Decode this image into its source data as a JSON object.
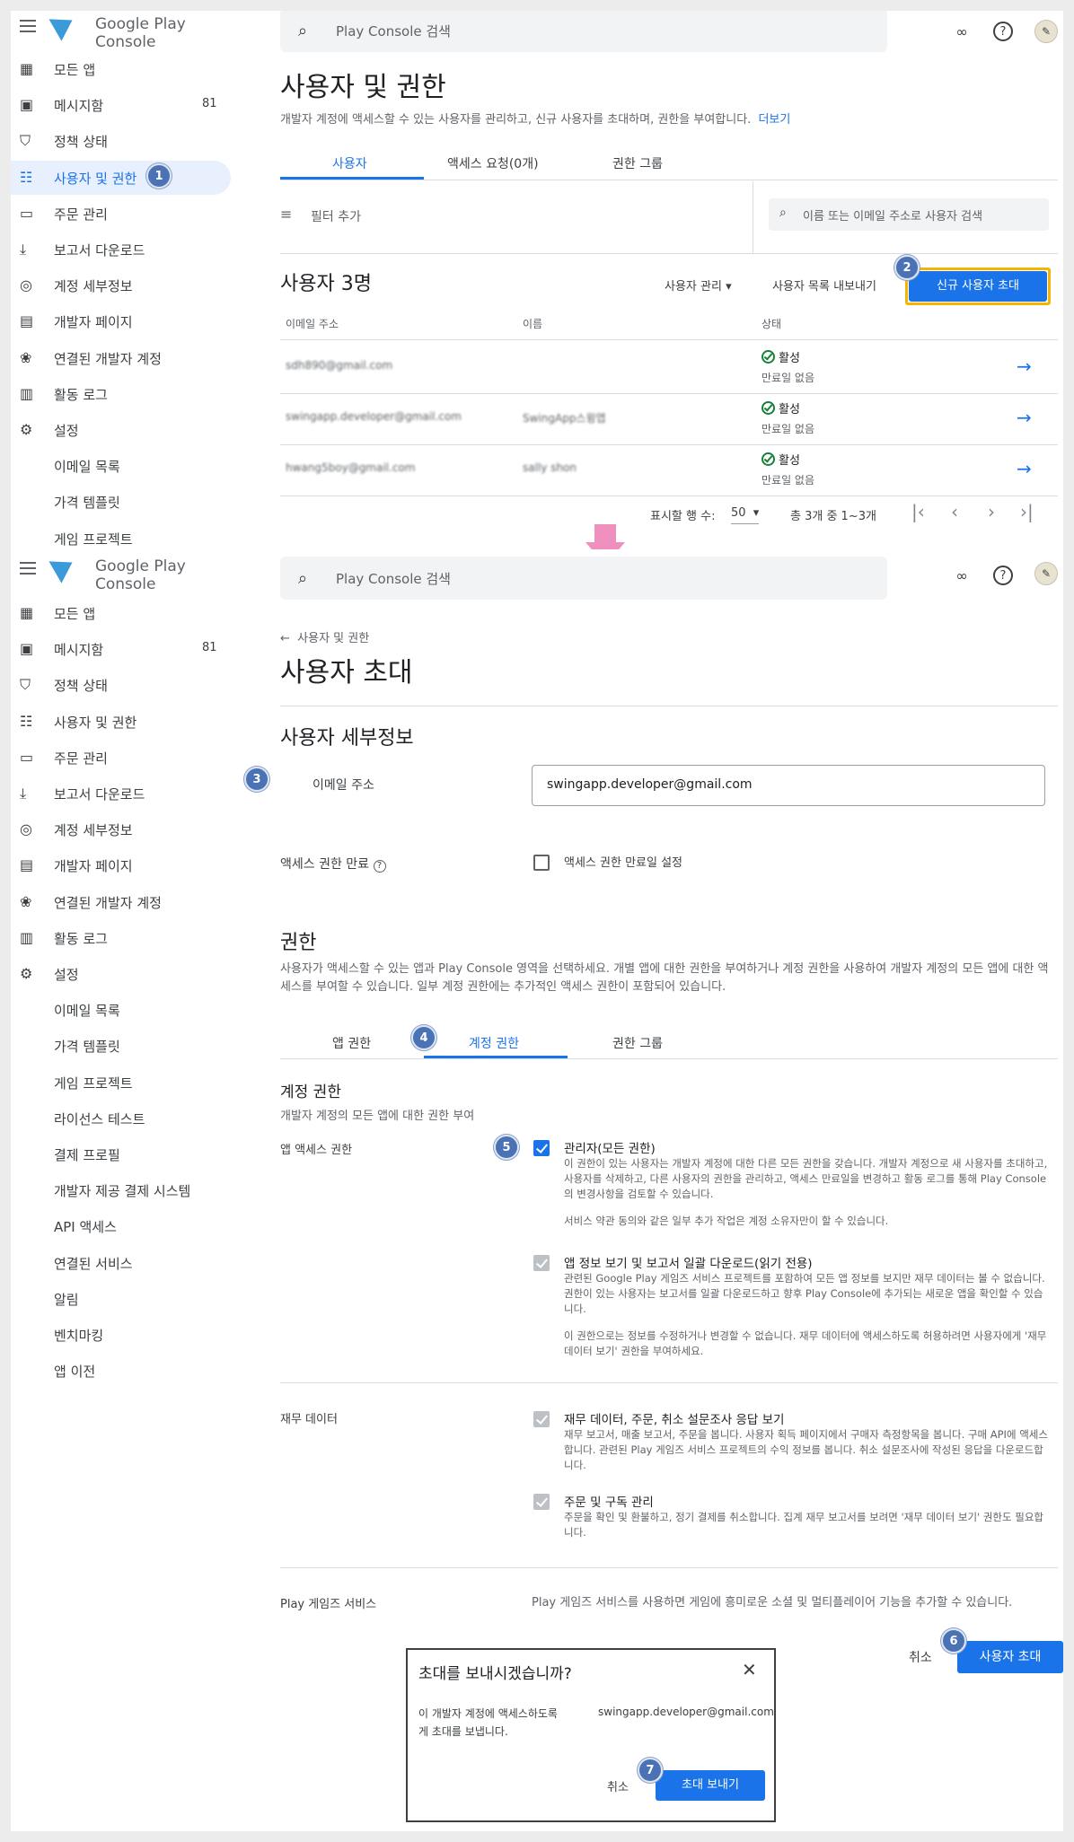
{
  "app": {
    "brand": "Google Play Console",
    "search_placeholder": "Play Console 검색"
  },
  "nav1": [
    {
      "label": "모든 앱",
      "icon": "grid-icon"
    },
    {
      "label": "메시지함",
      "count": "81",
      "icon": "inbox-icon"
    },
    {
      "label": "정책 상태",
      "icon": "shield-icon"
    },
    {
      "label": "사용자 및 권한",
      "icon": "users-icon",
      "selected": true
    },
    {
      "label": "주문 관리",
      "icon": "card-icon"
    },
    {
      "label": "보고서 다운로드",
      "icon": "download-icon"
    },
    {
      "label": "계정 세부정보",
      "icon": "account-icon"
    },
    {
      "label": "개발자 페이지",
      "icon": "page-icon"
    },
    {
      "label": "연결된 개발자 계정",
      "icon": "palette-icon"
    },
    {
      "label": "활동 로그",
      "icon": "doc-icon"
    },
    {
      "label": "설정",
      "icon": "gear-icon"
    },
    {
      "label": "이메일 목록"
    },
    {
      "label": "가격 템플릿"
    },
    {
      "label": "게임 프로젝트"
    }
  ],
  "nav2": [
    {
      "label": "모든 앱"
    },
    {
      "label": "메시지함",
      "count": "81"
    },
    {
      "label": "정책 상태"
    },
    {
      "label": "사용자 및 권한"
    },
    {
      "label": "주문 관리"
    },
    {
      "label": "보고서 다운로드"
    },
    {
      "label": "계정 세부정보"
    },
    {
      "label": "개발자 페이지"
    },
    {
      "label": "연결된 개발자 계정"
    },
    {
      "label": "활동 로그"
    },
    {
      "label": "설정"
    },
    {
      "label": "이메일 목록"
    },
    {
      "label": "가격 템플릿"
    },
    {
      "label": "게임 프로젝트"
    },
    {
      "label": "라이선스 테스트"
    },
    {
      "label": "결제 프로필"
    },
    {
      "label": "개발자 제공 결제 시스템"
    },
    {
      "label": "API 액세스"
    },
    {
      "label": "연결된 서비스"
    },
    {
      "label": "알림"
    },
    {
      "label": "벤치마킹"
    },
    {
      "label": "앱 이전"
    }
  ],
  "users_page": {
    "title": "사용자 및 권한",
    "subtitle": "개발자 계정에 액세스할 수 있는 사용자를 관리하고, 신규 사용자를 초대하며, 권한을 부여합니다.",
    "more_link": "더보기",
    "tabs": [
      "사용자",
      "액세스 요청(0개)",
      "권한 그룹"
    ],
    "filter": "필터 추가",
    "user_search": "이름 또는 이메일 주소로 사용자 검색",
    "count_title": "사용자 3명",
    "manage": "사용자 관리",
    "export": "사용자 목록 내보내기",
    "invite": "신규 사용자 초대",
    "columns": [
      "이메일 주소",
      "이름",
      "상태"
    ],
    "rows": [
      {
        "email": "sdh890@gmail.com",
        "name": "",
        "status": "활성",
        "expiry": "만료일 없음"
      },
      {
        "email": "swingapp.developer@gmail.com",
        "name": "SwingApp스윙앱",
        "status": "활성",
        "expiry": "만료일 없음"
      },
      {
        "email": "hwang5boy@gmail.com",
        "name": "sally shon",
        "status": "활성",
        "expiry": "만료일 없음"
      }
    ],
    "rows_label": "표시할 행 수:",
    "rows_value": "50",
    "range": "총 3개 중 1~3개"
  },
  "invite_page": {
    "back": "사용자 및 권한",
    "title": "사용자 초대",
    "details_title": "사용자 세부정보",
    "email_label": "이메일 주소",
    "email_value": "swingapp.developer@gmail.com",
    "expiry_label": "액세스 권한 만료",
    "expiry_checkbox": "액세스 권한 만료일 설정",
    "perm_title": "권한",
    "perm_desc": "사용자가 액세스할 수 있는 앱과 Play Console 영역을 선택하세요. 개별 앱에 대한 권한을 부여하거나 계정 권한을 사용하여 개발자 계정의 모든 앱에 대한 액세스를 부여할 수 있습니다. 일부 계정 권한에는 추가적인 액세스 권한이 포함되어 있습니다.",
    "tabs": [
      "앱 권한",
      "계정 권한",
      "권한 그룹"
    ],
    "acct_title": "계정 권한",
    "acct_sub": "개발자 계정의 모든 앱에 대한 권한 부여",
    "app_access": "앱 액세스 권한",
    "admin_label": "관리자(모든 권한)",
    "admin_desc": "이 권한이 있는 사용자는 개발자 계정에 대한 다른 모든 권한을 갖습니다. 개발자 계정으로 새 사용자를 초대하고, 사용자를 삭제하고, 다른 사용자의 권한을 관리하고, 액세스 만료일을 변경하고 활동 로그를 통해 Play Console의 변경사항을 검토할 수 있습니다.",
    "admin_desc2": "서비스 약관 동의와 같은 일부 추가 작업은 계정 소유자만이 할 수 있습니다.",
    "view_label": "앱 정보 보기 및 보고서 일괄 다운로드(읽기 전용)",
    "view_desc": "관련된 Google Play 게임즈 서비스 프로젝트를 포함하여 모든 앱 정보를 보지만 재무 데이터는 볼 수 없습니다. 권한이 있는 사용자는 보고서를 일괄 다운로드하고 향후 Play Console에 추가되는 새로운 앱을 확인할 수 있습니다.",
    "view_desc2": "이 권한으로는 정보를 수정하거나 변경할 수 없습니다. 재무 데이터에 액세스하도록 허용하려면 사용자에게 '재무 데이터 보기' 권한을 부여하세요.",
    "finance": "재무 데이터",
    "fin1_label": "재무 데이터, 주문, 취소 설문조사 응답 보기",
    "fin1_desc": "재무 보고서, 매출 보고서, 주문을 봅니다. 사용자 획득 페이지에서 구매자 측정항목을 봅니다. 구매 API에 액세스합니다. 관련된 Play 게임즈 서비스 프로젝트의 수익 정보를 봅니다. 취소 설문조사에 작성된 응답을 다운로드합니다.",
    "fin2_label": "주문 및 구독 관리",
    "fin2_desc": "주문을 확인 및 환불하고, 정기 결제를 취소합니다. 집계 재무 보고서를 보려면 '재무 데이터 보기' 권한도 필요합니다.",
    "games": "Play 게임즈 서비스",
    "games_desc": "Play 게임즈 서비스를 사용하면 게임에 흥미로운 소셜 및 멀티플레이어 기능을 추가할 수 있습니다."
  },
  "footer": {
    "cancel": "취소",
    "invite": "사용자 초대"
  },
  "dialog": {
    "title": "초대를 보내시겠습니까?",
    "body_pre": "이 개발자 계정에 액세스하도록",
    "email": "swingapp.developer@gmail.com",
    "body_post": "게 초대를 보냅니다.",
    "cancel": "취소",
    "send": "초대 보내기"
  },
  "steps": [
    "1",
    "2",
    "3",
    "4",
    "5",
    "6",
    "7"
  ],
  "colors": {
    "accent": "#1a73e8",
    "step": "#4a72b5",
    "highlight": "#f4b400",
    "arrow": "#ef8fbd"
  }
}
